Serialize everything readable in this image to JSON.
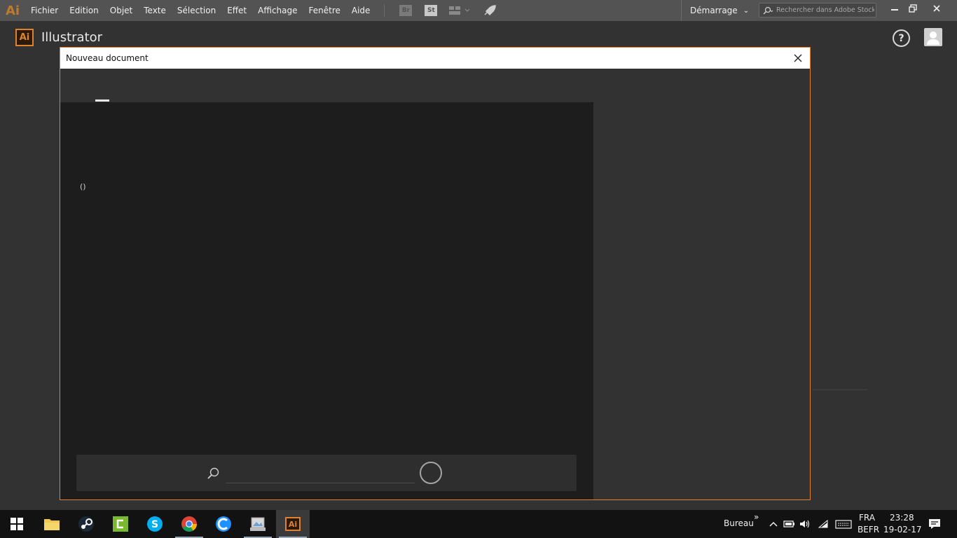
{
  "menubar": {
    "logo": "Ai",
    "items": [
      "Fichier",
      "Edition",
      "Objet",
      "Texte",
      "Sélection",
      "Effet",
      "Affichage",
      "Fenêtre",
      "Aide"
    ],
    "toolbar_icons": [
      {
        "name": "bridge-icon",
        "label": "Br"
      },
      {
        "name": "stock-icon",
        "label": "St"
      }
    ],
    "workspace": "Démarrage",
    "stock_search_placeholder": "Rechercher dans Adobe Stock"
  },
  "home": {
    "badge": "Ai",
    "title": "Illustrator",
    "help_glyph": "?"
  },
  "dialog": {
    "title": "Nouveau document",
    "paren_label": "()",
    "search_value": ""
  },
  "taskbar": {
    "tray_label": "Bureau",
    "chevron_glyph": "»",
    "lang_top": "FRA",
    "lang_bottom": "BEFR",
    "time": "23:28",
    "date": "19-02-17",
    "active_app_label": "Ai",
    "accent_colors": {
      "illustrator": "#e0822d",
      "taskbar": "#121212"
    }
  }
}
